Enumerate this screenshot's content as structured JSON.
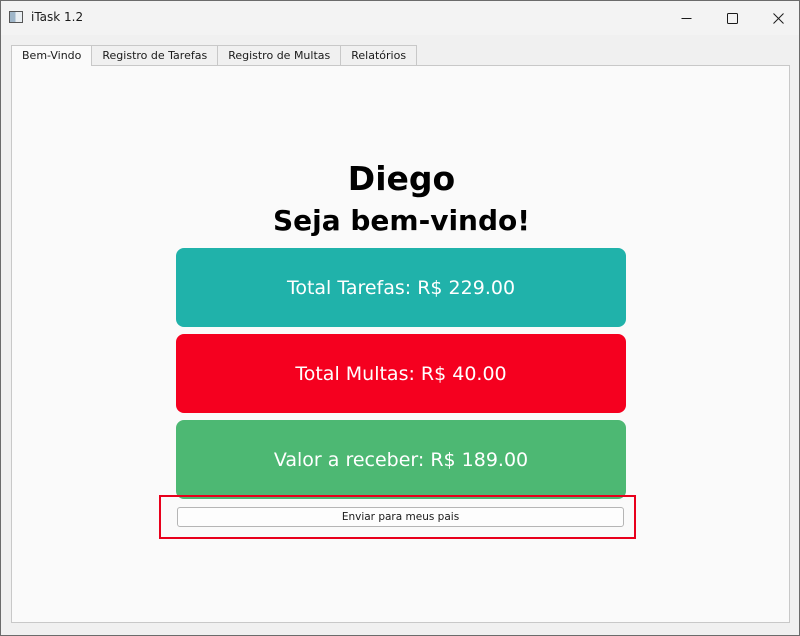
{
  "window": {
    "title": "iTask 1.2"
  },
  "tabs": [
    {
      "label": "Bem-Vindo",
      "active": true
    },
    {
      "label": "Registro de Tarefas",
      "active": false
    },
    {
      "label": "Registro de Multas",
      "active": false
    },
    {
      "label": "Relatórios",
      "active": false
    }
  ],
  "welcome": {
    "user_name": "Diego",
    "greeting": "Seja bem-vindo!"
  },
  "cards": {
    "tasks": {
      "text": "Total Tarefas: R$ 229.00",
      "color": "#20b2aa"
    },
    "fines": {
      "text": "Total Multas: R$ 40.00",
      "color": "#f5001f"
    },
    "receive": {
      "text": "Valor a receber: R$ 189.00",
      "color": "#4db873"
    }
  },
  "actions": {
    "send_label": "Enviar para meus pais"
  },
  "colors": {
    "highlight": "#e8001c",
    "window_bg": "#fafafa"
  },
  "icons": {
    "app": "app-window-icon",
    "minimize": "minimize-icon",
    "maximize": "maximize-icon",
    "close": "close-icon"
  }
}
